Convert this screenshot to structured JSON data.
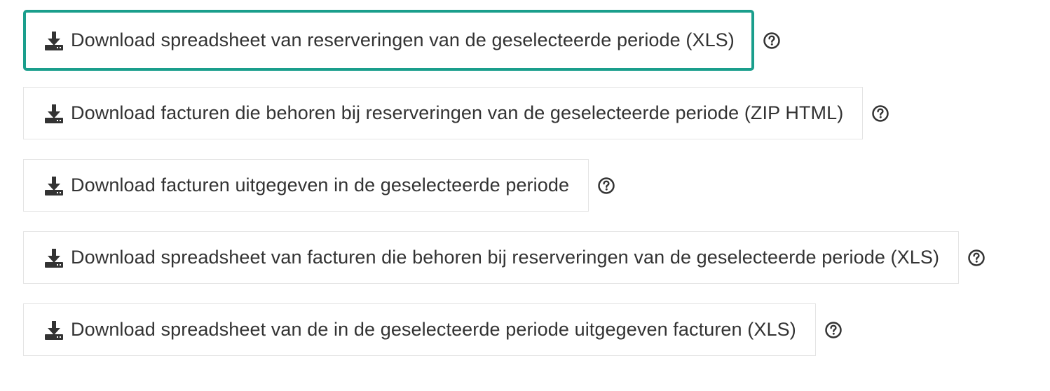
{
  "downloads": [
    {
      "label": "Download spreadsheet van reserveringen van de geselecteerde periode (XLS)",
      "icon": "download-icon",
      "help_icon": "question-circle-icon",
      "active": true
    },
    {
      "label": "Download facturen die behoren bij reserveringen van de geselecteerde periode (ZIP HTML)",
      "icon": "download-icon",
      "help_icon": "question-circle-icon",
      "active": false
    },
    {
      "label": "Download facturen uitgegeven in de geselecteerde periode",
      "icon": "download-icon",
      "help_icon": "question-circle-icon",
      "active": false
    },
    {
      "label": "Download spreadsheet van facturen die behoren bij reserveringen van de geselecteerde periode (XLS)",
      "icon": "download-icon",
      "help_icon": "question-circle-icon",
      "active": false
    },
    {
      "label": "Download spreadsheet van de in de geselecteerde periode uitgegeven facturen (XLS)",
      "icon": "download-icon",
      "help_icon": "question-circle-icon",
      "active": false
    }
  ],
  "colors": {
    "active_border": "#1a9e8c",
    "button_border": "#e4e4e4",
    "text": "#333333",
    "icon": "#333333"
  }
}
